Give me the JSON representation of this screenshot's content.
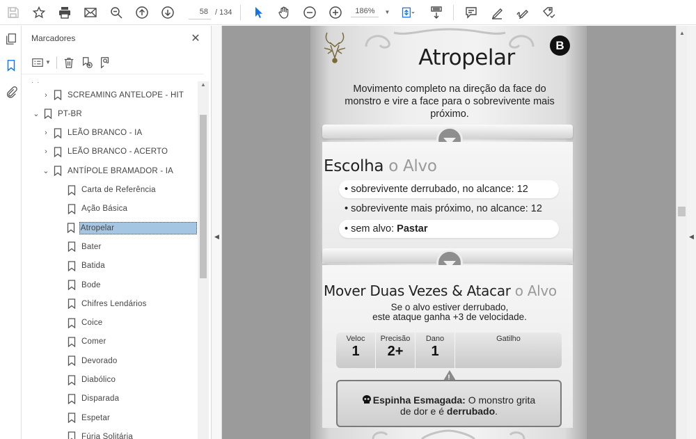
{
  "toolbar": {
    "page_current": "58",
    "page_total": "/ 134",
    "zoom": "186%"
  },
  "panel": {
    "title": "Marcadores",
    "close": "✕"
  },
  "bookmarks": {
    "overflow_dots": "· ·",
    "items": [
      {
        "label": "SCREAMING ANTELOPE - HIT",
        "twisty": "›"
      },
      {
        "label": "PT-BR",
        "twisty": "⌄"
      },
      {
        "label": "LEÃO BRANCO - IA",
        "twisty": "›"
      },
      {
        "label": "LEÃO BRANCO - ACERTO",
        "twisty": "›"
      },
      {
        "label": "ANTÍPOLE BRAMADOR - IA",
        "twisty": "⌄"
      },
      {
        "label": "Carta de Referência"
      },
      {
        "label": "Ação Básica"
      },
      {
        "label": "Atropelar",
        "selected": true
      },
      {
        "label": "Bater"
      },
      {
        "label": "Batida"
      },
      {
        "label": "Bode"
      },
      {
        "label": "Chifres Lendários"
      },
      {
        "label": "Coice"
      },
      {
        "label": "Comer"
      },
      {
        "label": "Devorado"
      },
      {
        "label": "Diabólico"
      },
      {
        "label": "Disparada"
      },
      {
        "label": "Espetar"
      },
      {
        "label": "Fúria Solitária"
      }
    ]
  },
  "card": {
    "badge": "B",
    "title": "Atropelar",
    "description": "Movimento completo na direção da face do monstro e vire a face para o sobrevivente mais próximo.",
    "target_section": {
      "heading_main": "Escolha",
      "heading_muted": "o Alvo",
      "options": [
        {
          "text": "• sobrevivente derrubado, no alcance: 12",
          "bold": ""
        },
        {
          "text": "• sobrevivente mais próximo, no alcance: 12",
          "bold": ""
        },
        {
          "text": "• sem alvo:",
          "bold": "Pastar"
        }
      ]
    },
    "action_section": {
      "heading_main": "Mover Duas Vezes & Atacar",
      "heading_muted": "o Alvo",
      "subtext_line1": "Se o alvo estiver derrubado,",
      "subtext_line2": "este ataque ganha +3 de velocidade.",
      "stats": [
        {
          "label": "Veloc",
          "value": "1"
        },
        {
          "label": "Precisão",
          "value": "2+"
        },
        {
          "label": "Dano",
          "value": "1"
        },
        {
          "label": "Gatilho",
          "value": ""
        }
      ]
    },
    "effect": {
      "bold_title": "Espinha Esmagada:",
      "text_a": "O monstro grita",
      "text_b": "de dor e é",
      "bold_word": "derrubado",
      "end": "."
    }
  },
  "colors": {
    "accent": "#1473e6",
    "selection": "#a5c6e3",
    "doc_background": "#9b9b9b"
  }
}
